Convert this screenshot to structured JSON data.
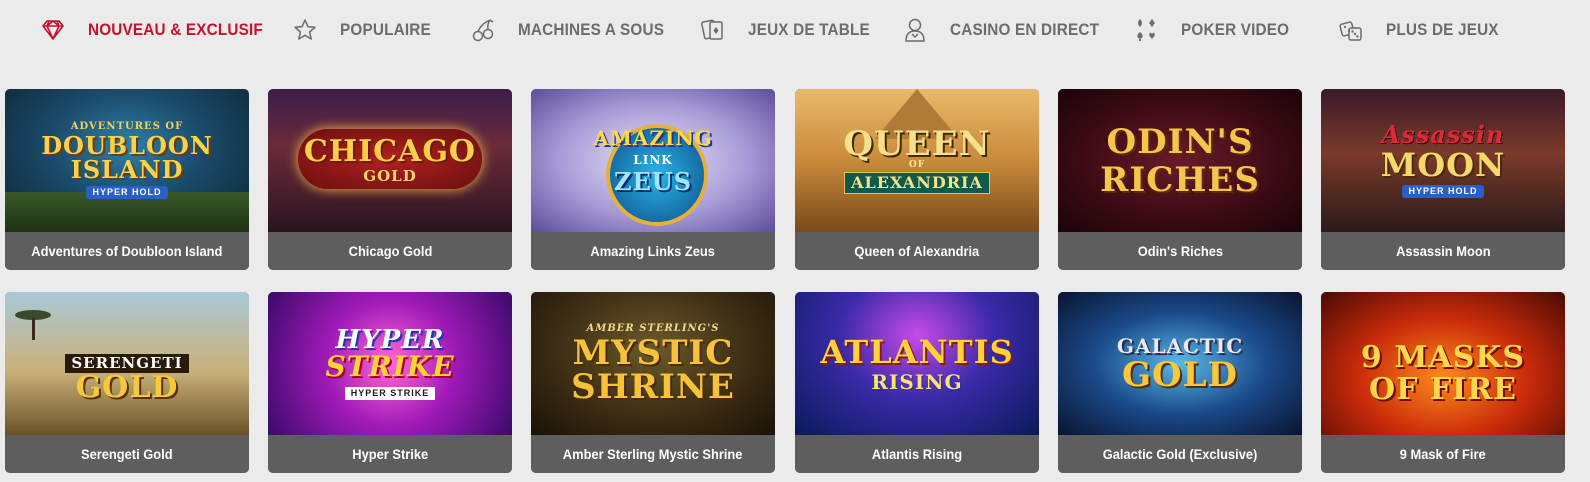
{
  "nav": {
    "items": [
      {
        "label": "NOUVEAU & EXCLUSIF",
        "icon": "diamond-icon",
        "active": true
      },
      {
        "label": "POPULAIRE",
        "icon": "star-icon",
        "active": false
      },
      {
        "label": "MACHINES A SOUS",
        "icon": "cherries-icon",
        "active": false
      },
      {
        "label": "JEUX DE TABLE",
        "icon": "playing-cards-icon",
        "active": false
      },
      {
        "label": "CASINO EN DIRECT",
        "icon": "live-dealer-icon",
        "active": false
      },
      {
        "label": "POKER VIDEO",
        "icon": "card-suits-icon",
        "active": false
      },
      {
        "label": "PLUS DE JEUX",
        "icon": "dice-icon",
        "active": false
      }
    ]
  },
  "games": [
    {
      "title": "Adventures of Doubloon Island",
      "logo": [
        "ADVENTURES OF",
        "DOUBLOON",
        "ISLAND",
        "HYPER HOLD"
      ]
    },
    {
      "title": "Chicago Gold",
      "logo": [
        "CHICAGO",
        "GOLD"
      ]
    },
    {
      "title": "Amazing Links Zeus",
      "logo": [
        "AMAZING",
        "LINK",
        "ZEUS"
      ]
    },
    {
      "title": "Queen of Alexandria",
      "logo": [
        "QUEEN",
        "OF",
        "ALEXANDRIA"
      ]
    },
    {
      "title": "Odin's Riches",
      "logo": [
        "ODIN'S",
        "RICHES"
      ]
    },
    {
      "title": "Assassin Moon",
      "logo": [
        "Assassin",
        "MOON",
        "HYPER HOLD"
      ]
    },
    {
      "title": "Serengeti Gold",
      "logo": [
        "SERENGETI",
        "GOLD"
      ]
    },
    {
      "title": "Hyper Strike",
      "logo": [
        "HYPER",
        "STRIKE",
        "HYPER STRIKE"
      ]
    },
    {
      "title": "Amber Sterling Mystic Shrine",
      "logo": [
        "AMBER STERLING'S",
        "MYSTIC",
        "SHRINE"
      ]
    },
    {
      "title": "Atlantis Rising",
      "logo": [
        "ATLANTIS",
        "RISING"
      ]
    },
    {
      "title": "Galactic Gold (Exclusive)",
      "logo": [
        "GALACTIC",
        "GOLD"
      ]
    },
    {
      "title": "9 Mask of Fire",
      "logo": [
        "9 MASKS",
        "OF FIRE"
      ]
    }
  ],
  "colors": {
    "accent": "#c8102e",
    "nav_text": "#6b6b70",
    "caption_bg": "#5e5e5e",
    "page_bg": "#ebebeb"
  }
}
